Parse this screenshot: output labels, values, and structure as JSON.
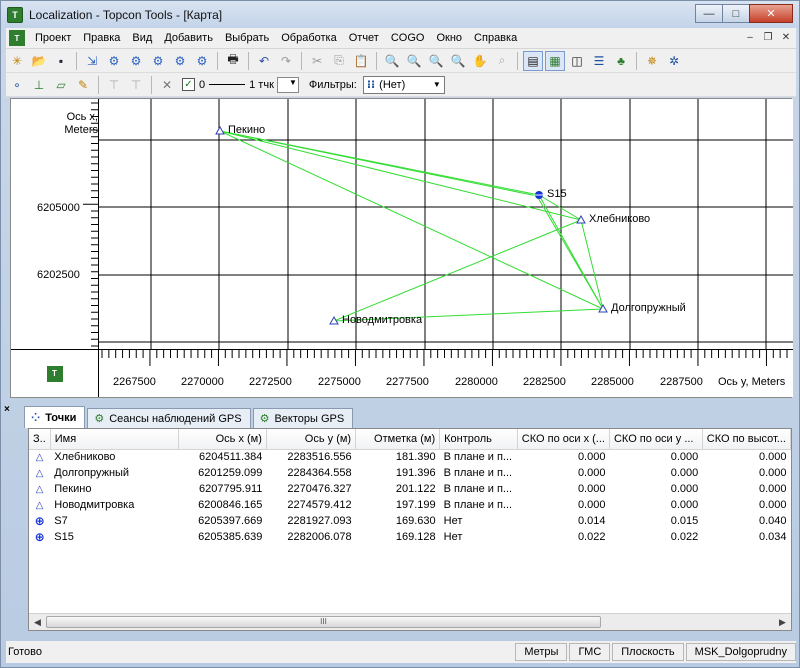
{
  "window": {
    "title": "Localization - Topcon Tools - [Карта]",
    "app_icon_text": "T"
  },
  "menu": [
    "Проект",
    "Правка",
    "Вид",
    "Добавить",
    "Выбрать",
    "Обработка",
    "Отчет",
    "COGO",
    "Окно",
    "Справка"
  ],
  "toolbar2": {
    "checkbox_label": "0",
    "line_label": "1 тчк",
    "filter_label": "Фильтры:",
    "filter_value": "(Нет)"
  },
  "map": {
    "y_axis_title": "Ось x, Meters",
    "x_axis_title": "Ось y, Meters",
    "y_ticks": [
      "6205000",
      "6202500"
    ],
    "x_ticks": [
      "2267500",
      "2270000",
      "2272500",
      "2275000",
      "2277500",
      "2280000",
      "2282500",
      "2285000",
      "2287500"
    ],
    "points": [
      {
        "name": "Пекино",
        "icon": "triangle-icon"
      },
      {
        "name": "S15",
        "icon": "gps-icon"
      },
      {
        "name": "Хлебниково",
        "icon": "triangle-icon"
      },
      {
        "name": "Долгопружный",
        "icon": "triangle-icon"
      },
      {
        "name": "Новодмитровка",
        "icon": "triangle-icon"
      }
    ]
  },
  "tabs": [
    {
      "label": "Точки",
      "active": true
    },
    {
      "label": "Сеансы наблюдений GPS",
      "active": false
    },
    {
      "label": "Векторы GPS",
      "active": false
    }
  ],
  "table": {
    "columns": [
      "З..",
      "Имя",
      "Ось x (м)",
      "Ось y (м)",
      "Отметка (м)",
      "Контроль",
      "СКО по оси x (...",
      "СКО по оси y ...",
      "СКО по высот..."
    ],
    "rows": [
      {
        "icon": "triangle-icon",
        "name": "Хлебниково",
        "x": "6204511.384",
        "y": "2283516.556",
        "h": "181.390",
        "control": "В плане и п...",
        "sx": "0.000",
        "sy": "0.000",
        "sh": "0.000"
      },
      {
        "icon": "triangle-icon",
        "name": "Долгопружный",
        "x": "6201259.099",
        "y": "2284364.558",
        "h": "191.396",
        "control": "В плане и п...",
        "sx": "0.000",
        "sy": "0.000",
        "sh": "0.000"
      },
      {
        "icon": "triangle-icon",
        "name": "Пекино",
        "x": "6207795.911",
        "y": "2270476.327",
        "h": "201.122",
        "control": "В плане и п...",
        "sx": "0.000",
        "sy": "0.000",
        "sh": "0.000"
      },
      {
        "icon": "triangle-icon",
        "name": "Новодмитровка",
        "x": "6200846.165",
        "y": "2274579.412",
        "h": "197.199",
        "control": "В плане и п...",
        "sx": "0.000",
        "sy": "0.000",
        "sh": "0.000"
      },
      {
        "icon": "gps-icon",
        "name": "S7",
        "x": "6205397.669",
        "y": "2281927.093",
        "h": "169.630",
        "control": "Нет",
        "sx": "0.014",
        "sy": "0.015",
        "sh": "0.040"
      },
      {
        "icon": "gps-icon",
        "name": "S15",
        "x": "6205385.639",
        "y": "2282006.078",
        "h": "169.128",
        "control": "Нет",
        "sx": "0.022",
        "sy": "0.022",
        "sh": "0.034"
      }
    ]
  },
  "status": {
    "text": "Готово",
    "cells": [
      "Метры",
      "ГМС",
      "Плоскость",
      "MSK_Dolgoprudny"
    ]
  },
  "colors": {
    "vector_line": "#33dd33",
    "point_marker": "#2b3fb8",
    "grid": "#000000"
  }
}
